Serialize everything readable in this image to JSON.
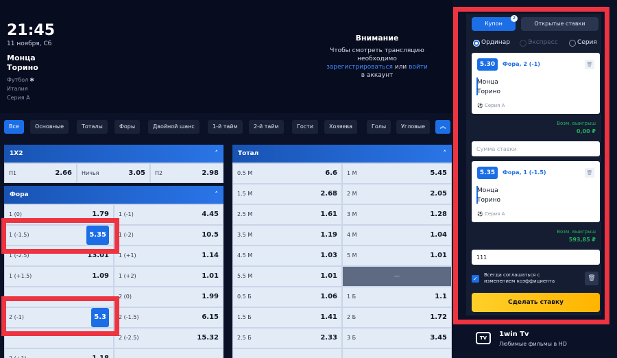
{
  "match": {
    "time": "21:45",
    "date": "11 ноября, Сб",
    "team1": "Монца",
    "team2": "Торино",
    "sport": "Футбол",
    "country": "Италия",
    "league": "Серия А"
  },
  "notice": {
    "title": "Внимание",
    "line1": "Чтобы смотреть трансляцию",
    "line2": "необходимо",
    "register_link": "зарегистрироваться",
    "or": "или",
    "login_link": "войти",
    "line3": "в аккаунт"
  },
  "filters": {
    "all": "Все",
    "main": "Основные",
    "totals": "Тоталы",
    "handicaps": "Форы",
    "double_chance": "Двойной шанс",
    "first_half": "1-й тайм",
    "second_half": "2-й тайм",
    "away": "Гости",
    "home": "Хозяева",
    "goals": "Голы",
    "corners": "Угловые",
    "collapse_icon": "chevrons-up-icon"
  },
  "market_1x2": {
    "title": "1X2",
    "items": [
      {
        "label": "П1",
        "odd": "2.66"
      },
      {
        "label": "Ничья",
        "odd": "3.05"
      },
      {
        "label": "П2",
        "odd": "2.98"
      }
    ]
  },
  "market_handicap": {
    "title": "Фора",
    "left": [
      {
        "label": "1 (0)",
        "odd": "1.79"
      },
      {
        "label": "1 (-1.5)",
        "odd": "5.35"
      },
      {
        "label": "1 (-2.5)",
        "odd": "13.01"
      },
      {
        "label": "1 (+1.5)",
        "odd": "1.09"
      },
      {
        "label": "",
        "odd": ""
      },
      {
        "label": "2 (-1)",
        "odd": "5.3"
      },
      {
        "label": "",
        "odd": ""
      },
      {
        "label": "2 (+1)",
        "odd": "1.18"
      }
    ],
    "right": [
      {
        "label": "1 (-1)",
        "odd": "4.45"
      },
      {
        "label": "1 (-2)",
        "odd": "10.5"
      },
      {
        "label": "1 (+1)",
        "odd": "1.14"
      },
      {
        "label": "1 (+2)",
        "odd": "1.01"
      },
      {
        "label": "2 (0)",
        "odd": "1.99"
      },
      {
        "label": "2 (-1.5)",
        "odd": "6.15"
      },
      {
        "label": "2 (-2.5)",
        "odd": "15.32"
      },
      {
        "label": "",
        "odd": ""
      }
    ]
  },
  "market_total": {
    "title": "Тотал",
    "left": [
      {
        "label": "0.5 М",
        "odd": "6.6"
      },
      {
        "label": "1.5 М",
        "odd": "2.68"
      },
      {
        "label": "2.5 М",
        "odd": "1.61"
      },
      {
        "label": "3.5 М",
        "odd": "1.19"
      },
      {
        "label": "4.5 М",
        "odd": "1.03"
      },
      {
        "label": "5.5 М",
        "odd": "1.01"
      },
      {
        "label": "0.5 Б",
        "odd": "1.06"
      },
      {
        "label": "1.5 Б",
        "odd": "1.41"
      },
      {
        "label": "2.5 Б",
        "odd": "2.33"
      },
      {
        "label": "",
        "odd": ""
      }
    ],
    "right": [
      {
        "label": "1 М",
        "odd": "5.45"
      },
      {
        "label": "2 М",
        "odd": "2.05"
      },
      {
        "label": "3 М",
        "odd": "1.28"
      },
      {
        "label": "4 М",
        "odd": "1.04"
      },
      {
        "label": "5 М",
        "odd": "1.01"
      },
      {
        "label": "—",
        "odd": ""
      },
      {
        "label": "1 Б",
        "odd": "1.1"
      },
      {
        "label": "2 Б",
        "odd": "1.72"
      },
      {
        "label": "3 Б",
        "odd": "3.45"
      },
      {
        "label": "",
        "odd": ""
      }
    ]
  },
  "coupon": {
    "tab_coupon": "Купон",
    "badge": "2",
    "tab_open": "Открытые ставки",
    "mode_single": "Ординар",
    "mode_express": "Экспресс",
    "mode_series": "Серия",
    "bets": [
      {
        "odd": "5.30",
        "type": "Фора, 2 (-1)",
        "team1": "Монца",
        "team2": "Торино",
        "league": "Серия А",
        "pot_label": "Возм. выигрыш",
        "pot_value": "0,00 ₽",
        "stake_value": "",
        "stake_placeholder": "Сумма ставки"
      },
      {
        "odd": "5.35",
        "type": "Фора, 1 (-1.5)",
        "team1": "Монца",
        "team2": "Торино",
        "league": "Серия А",
        "pot_label": "Возм. выигрыш",
        "pot_value": "593,85 ₽",
        "stake_value": "111",
        "stake_placeholder": ""
      }
    ],
    "agree_text": "Всегда соглашаться с изменением коэффициента",
    "cta": "Сделать ставку"
  },
  "tv": {
    "icon": "TV",
    "title": "1win Tv",
    "subtitle": "Любимые фильмы в HD"
  }
}
